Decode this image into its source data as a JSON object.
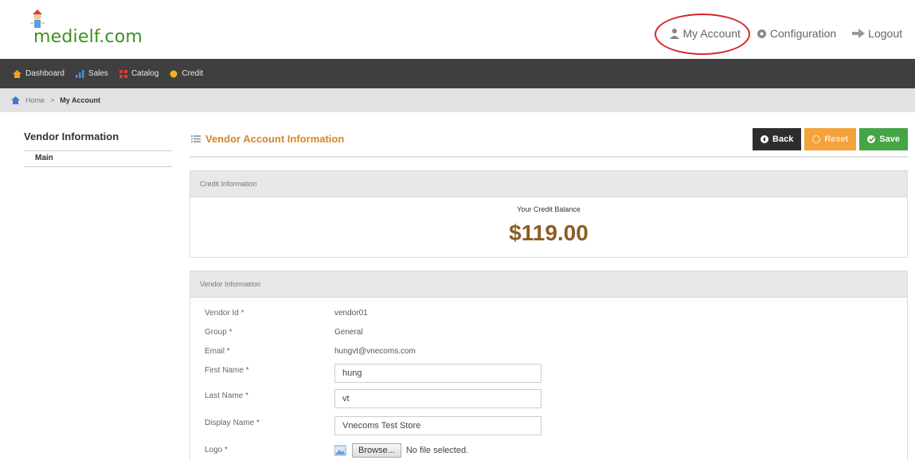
{
  "header": {
    "logo_text": "medielf.com",
    "links": [
      {
        "label": "My Account",
        "icon": "user-icon"
      },
      {
        "label": "Configuration",
        "icon": "gear-icon"
      },
      {
        "label": "Logout",
        "icon": "logout-arrow-icon"
      }
    ]
  },
  "nav": {
    "items": [
      {
        "label": "Dashboard",
        "icon": "home-icon",
        "color": "#f2a31b"
      },
      {
        "label": "Sales",
        "icon": "bar-chart-icon",
        "color": "#4a90d9"
      },
      {
        "label": "Catalog",
        "icon": "catalog-icon",
        "color": "#d63c3c"
      },
      {
        "label": "Credit",
        "icon": "coin-icon",
        "color": "#f2b01e"
      }
    ]
  },
  "breadcrumb": {
    "home": "Home",
    "separator": ">",
    "current": "My Account"
  },
  "sidebar": {
    "title": "Vendor Information",
    "items": [
      {
        "label": "Main"
      }
    ]
  },
  "page": {
    "title": "Vendor Account Information",
    "buttons": {
      "back": "Back",
      "reset": "Reset",
      "save": "Save"
    }
  },
  "credit": {
    "panel_title": "Credit Information",
    "label": "Your Credit Balance",
    "amount": "$119.00"
  },
  "vendor": {
    "panel_title": "Vendor Information",
    "fields": {
      "vendor_id": {
        "label": "Vendor Id *",
        "value": "vendor01"
      },
      "group": {
        "label": "Group *",
        "value": "General"
      },
      "email": {
        "label": "Email *",
        "value": "hungvt@vnecoms.com"
      },
      "first_name": {
        "label": "First Name *",
        "value": "hung"
      },
      "last_name": {
        "label": "Last Name *",
        "value": "vt"
      },
      "display_name": {
        "label": "Display Name *",
        "value": "Vnecoms Test Store"
      },
      "logo": {
        "label": "Logo *",
        "browse": "Browse...",
        "status": "No file selected."
      }
    }
  },
  "colors": {
    "nav_bg": "#3f3f3f",
    "title_orange": "#d4862a",
    "amount_brown": "#8a5d22",
    "save_green": "#43a543",
    "reset_orange": "#f4a23a",
    "back_dark": "#2d2d2d",
    "annotation_red": "#d62727"
  }
}
